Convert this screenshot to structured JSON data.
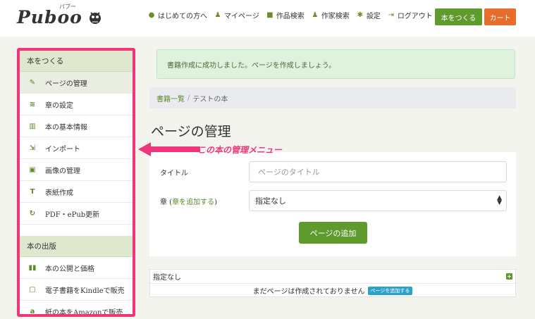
{
  "header": {
    "logo_text": "Puboo",
    "logo_kana": "パブー",
    "nav": [
      {
        "label": "はじめての方へ",
        "icon": "info-circle-icon",
        "glyph": "●"
      },
      {
        "label": "マイページ",
        "icon": "user-icon",
        "glyph": "♟"
      },
      {
        "label": "作品検索",
        "icon": "book-icon",
        "glyph": "■"
      },
      {
        "label": "作家検索",
        "icon": "users-icon",
        "glyph": "♟"
      },
      {
        "label": "設定",
        "icon": "gear-icon",
        "glyph": "✱"
      },
      {
        "label": "ログアウト",
        "icon": "logout-icon",
        "glyph": "⇥"
      }
    ],
    "make_book_label": "本をつくる",
    "cart_label": "カート"
  },
  "sidebar": {
    "section1_title": "本をつくる",
    "items1": [
      {
        "label": "ページの管理",
        "icon": "edit-icon",
        "glyph": "✎"
      },
      {
        "label": "章の設定",
        "icon": "layers-icon",
        "glyph": "≋"
      },
      {
        "label": "本の基本情報",
        "icon": "barcode-icon",
        "glyph": "▥"
      },
      {
        "label": "インポート",
        "icon": "import-icon",
        "glyph": "⇲"
      },
      {
        "label": "画像の管理",
        "icon": "image-icon",
        "glyph": "▣"
      },
      {
        "label": "表紙作成",
        "icon": "text-icon",
        "glyph": "T"
      },
      {
        "label": "PDF・ePub更新",
        "icon": "refresh-icon",
        "glyph": "↻"
      }
    ],
    "section2_title": "本の出版",
    "items2": [
      {
        "label": "本の公開と価格",
        "icon": "open-book-icon",
        "glyph": "▮▮"
      },
      {
        "label": "電子書籍をKindleで販売",
        "icon": "tablet-icon",
        "glyph": "▢"
      },
      {
        "label": "紙の本をAmazonで販売",
        "icon": "amazon-icon",
        "glyph": "a"
      }
    ]
  },
  "alert": "書籍作成に成功しました。ページを作成しましょう。",
  "breadcrumb": {
    "link": "書籍一覧",
    "current": "テストの本"
  },
  "page_title": "ページの管理",
  "form": {
    "title_label": "タイトル",
    "title_placeholder": "ページのタイトル",
    "chapter_label_prefix": "章 (",
    "chapter_label_link": "章を追加する",
    "chapter_label_suffix": ")",
    "chapter_selected": "指定なし",
    "add_button": "ページの追加"
  },
  "chapter_list": {
    "header": "指定なし",
    "empty_message": "まだページは作成されておりません",
    "add_page_badge": "ページを追加する"
  },
  "annotation": "この本の管理メニュー",
  "colors": {
    "accent_green": "#5e9a2c",
    "cart_orange": "#e86c2c",
    "highlight_pink": "#f0357a"
  }
}
